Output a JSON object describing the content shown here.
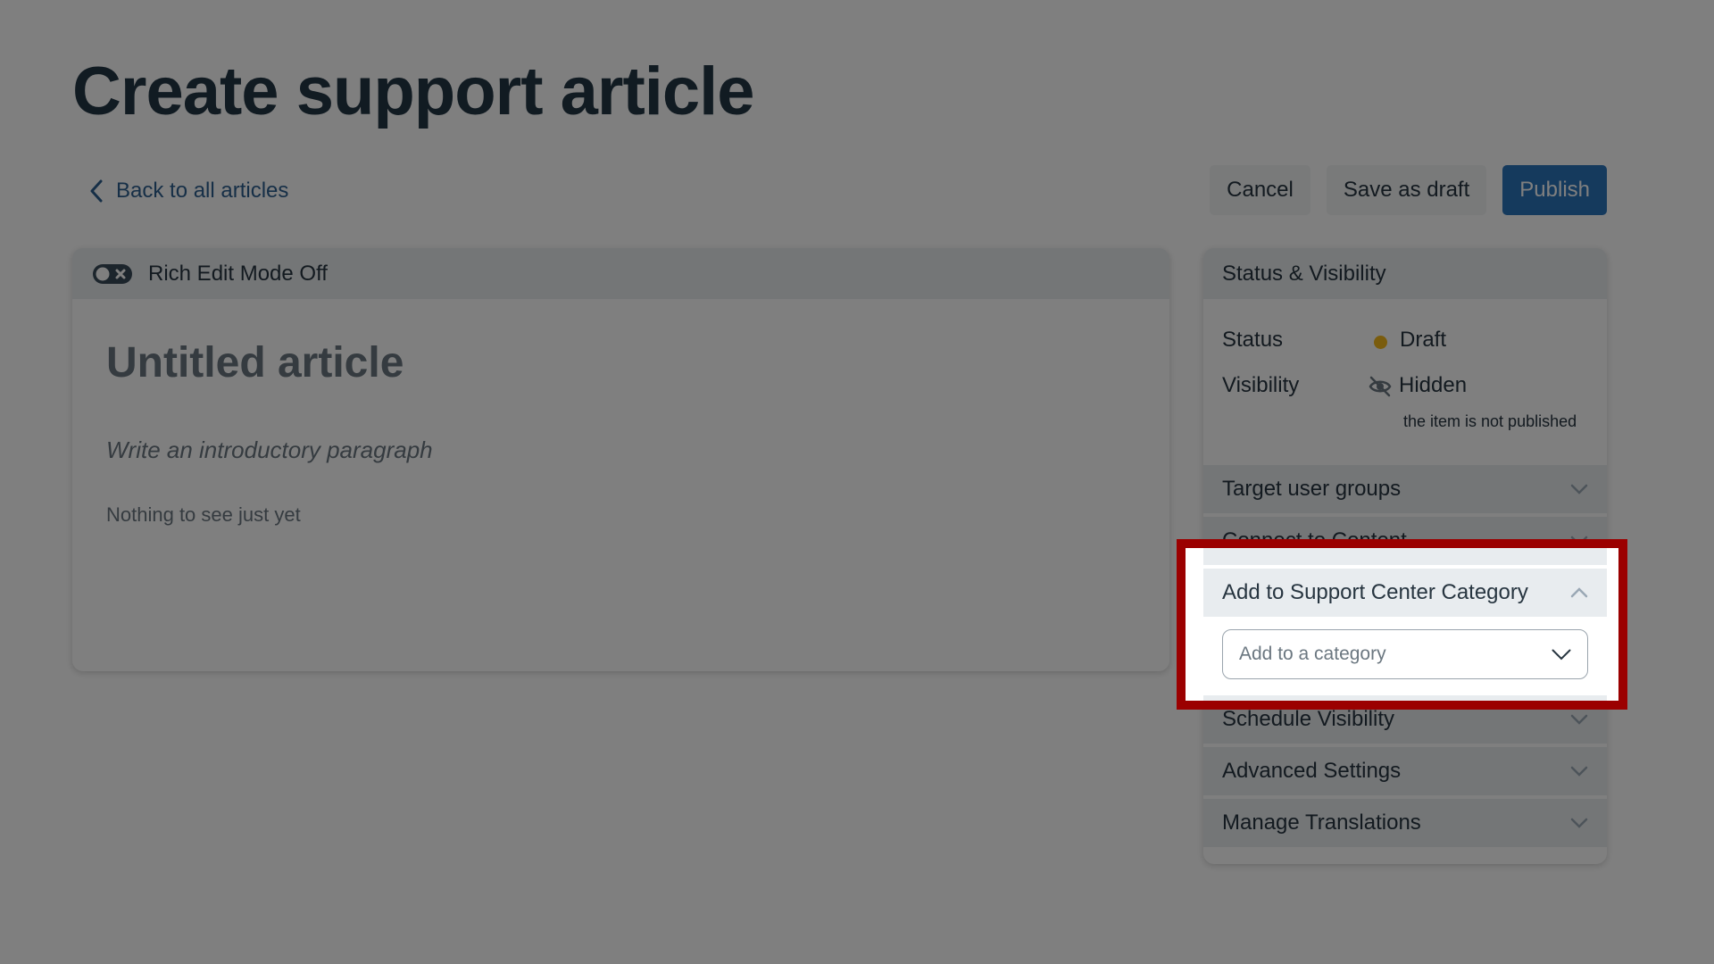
{
  "page": {
    "title": "Create support article",
    "back_link": "Back to all articles"
  },
  "actions": {
    "cancel": "Cancel",
    "save_draft": "Save as draft",
    "publish": "Publish"
  },
  "editor": {
    "mode_label": "Rich Edit Mode Off",
    "mode_icon": "toggle-off-icon",
    "title_placeholder": "Untitled article",
    "intro_placeholder": "Write an introductory paragraph",
    "empty_text": "Nothing to see just yet"
  },
  "sidebar": {
    "status_visibility": {
      "heading": "Status & Visibility",
      "status_label": "Status",
      "status_value": "Draft",
      "status_color": "#f5b91a",
      "visibility_label": "Visibility",
      "visibility_icon": "eye-slash-icon",
      "visibility_value": "Hidden",
      "visibility_note": "the item is not published"
    },
    "sections": [
      {
        "label": "Target user groups",
        "expanded": false
      },
      {
        "label": "Connect to Content",
        "expanded": false
      },
      {
        "label": "Add to Support Center Category",
        "expanded": true
      },
      {
        "label": "Schedule Visibility",
        "expanded": false
      },
      {
        "label": "Advanced Settings",
        "expanded": false
      },
      {
        "label": "Manage Translations",
        "expanded": false
      }
    ],
    "category_select": {
      "placeholder": "Add to a category"
    }
  },
  "highlight": {
    "color": "#9b0000",
    "target": "Add to Support Center Category"
  }
}
